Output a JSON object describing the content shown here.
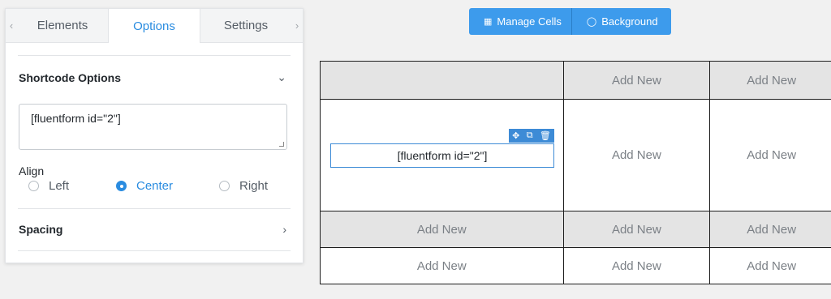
{
  "panel": {
    "tabs": [
      {
        "label": "Elements"
      },
      {
        "label": "Options"
      },
      {
        "label": "Settings"
      }
    ],
    "shortcode_options": {
      "title": "Shortcode Options",
      "value": "[fluentform id=\"2\"]"
    },
    "align": {
      "label": "Align",
      "options": [
        "Left",
        "Center",
        "Right"
      ],
      "selected": "Center"
    },
    "spacing": {
      "title": "Spacing"
    }
  },
  "toolbar": {
    "manage_cells": "Manage Cells",
    "background": "Background"
  },
  "grid": {
    "placeholder": "Add New",
    "block_text": "[fluentform id=\"2\"]"
  },
  "colors": {
    "accent": "#2a8ce0",
    "button": "#3d9bec"
  }
}
